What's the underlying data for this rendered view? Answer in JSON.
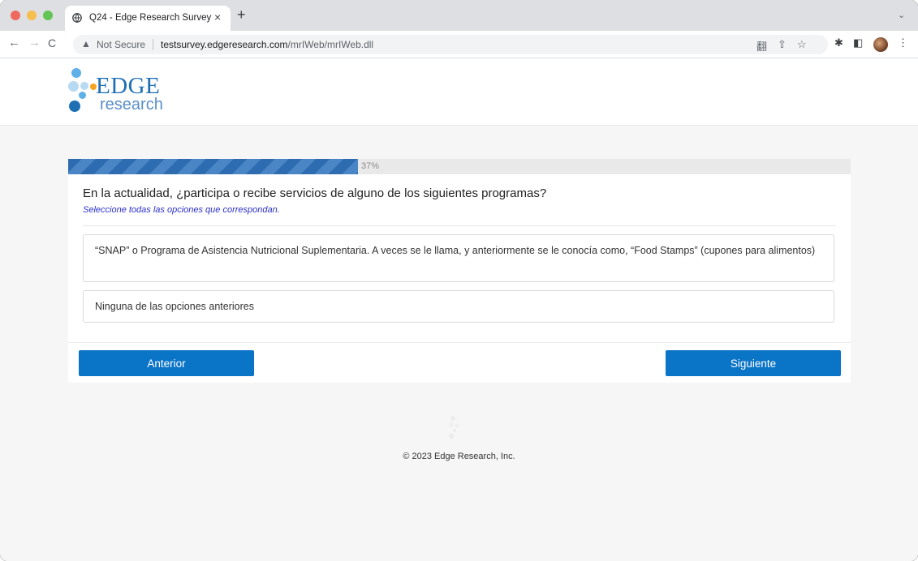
{
  "browser": {
    "tab": {
      "title": "Q24 - Edge Research Survey",
      "close_glyph": "×",
      "favicon": "globe-icon"
    },
    "new_tab_glyph": "+",
    "tab_dropdown_glyph": "⌄",
    "nav": {
      "back_glyph": "←",
      "forward_glyph": "→",
      "reload_glyph": "C"
    },
    "omnibox": {
      "security_icon": "warning-triangle-icon",
      "security_glyph": "▲",
      "security_label": "Not Secure",
      "url_host": "testsurvey.edgeresearch.com",
      "url_path": "/mrIWeb/mrIWeb.dll"
    },
    "toolbar_icons": {
      "translate": "翻",
      "share": "⇧",
      "bookmark": "☆",
      "extensions": "✱",
      "sidepanel": "◧",
      "menu": "⋮"
    }
  },
  "logo": {
    "primary": "EDGE",
    "secondary": "research",
    "colors": {
      "blue": "#1f6fb5",
      "light_blue": "#b7d9f2",
      "orange": "#f4a21f",
      "mid_blue": "#5fb0e8"
    }
  },
  "survey": {
    "progress": {
      "percent": 37,
      "label": "37%"
    },
    "question": "En la actualidad, ¿participa o recibe servicios de alguno de los siguientes programas?",
    "instruction": "Seleccione todas las opciones que correspondan.",
    "options": [
      {
        "label": "“SNAP” o Programa de Asistencia Nutricional Suplementaria. A veces se le llama, y anteriormente se le conocía como, “Food Stamps” (cupones para alimentos)"
      },
      {
        "label": "Ninguna de las opciones anteriores"
      }
    ],
    "buttons": {
      "previous": "Anterior",
      "next": "Siguiente"
    },
    "accent_color": "#0a74c7"
  },
  "footer": {
    "copyright": "© 2023 Edge Research, Inc."
  }
}
